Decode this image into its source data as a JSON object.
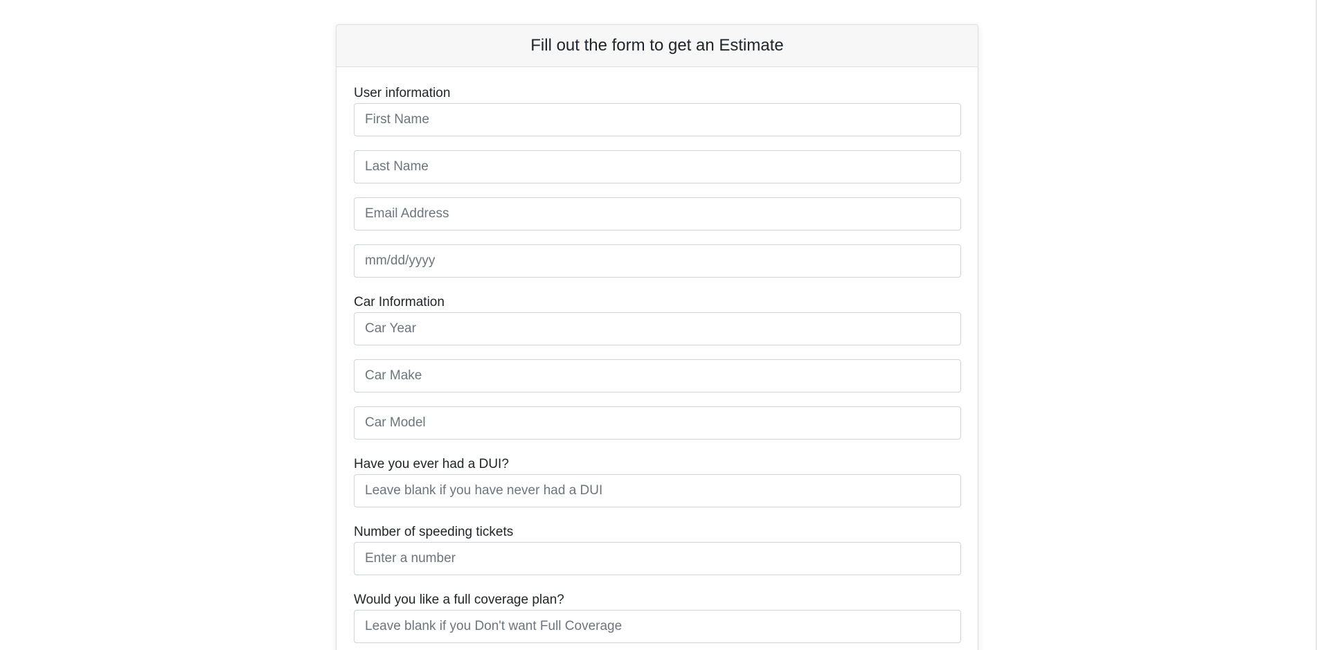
{
  "form": {
    "title": "Fill out the form to get an Estimate",
    "user_section_label": "User information",
    "first_name_placeholder": "First Name",
    "last_name_placeholder": "Last Name",
    "email_placeholder": "Email Address",
    "dob_placeholder": "mm/dd/yyyy",
    "car_section_label": "Car Information",
    "car_year_placeholder": "Car Year",
    "car_make_placeholder": "Car Make",
    "car_model_placeholder": "Car Model",
    "dui_label": "Have you ever had a DUI?",
    "dui_placeholder": "Leave blank if you have never had a DUI",
    "tickets_label": "Number of speeding tickets",
    "tickets_placeholder": "Enter a number",
    "coverage_label": "Would you like a full coverage plan?",
    "coverage_placeholder": "Leave blank if you Don't want Full Coverage"
  }
}
